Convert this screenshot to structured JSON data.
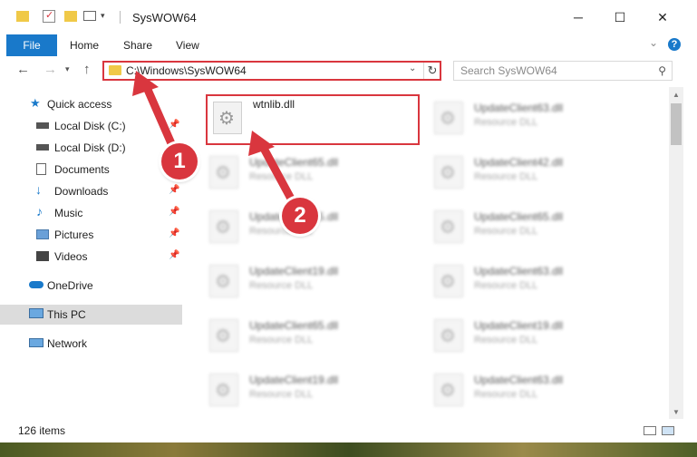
{
  "window": {
    "title": "SysWOW64"
  },
  "ribbon": {
    "tabs": [
      "File",
      "Home",
      "Share",
      "View"
    ],
    "help": "?"
  },
  "nav": {
    "address": "C:\\Windows\\SysWOW64",
    "search_placeholder": "Search SysWOW64"
  },
  "sidebar": {
    "items": [
      {
        "label": "Quick access",
        "icon": "star-icon"
      },
      {
        "label": "Local Disk (C:)",
        "icon": "drive-icon"
      },
      {
        "label": "Local Disk (D:)",
        "icon": "drive-icon"
      },
      {
        "label": "Documents",
        "icon": "documents-icon"
      },
      {
        "label": "Downloads",
        "icon": "download-icon"
      },
      {
        "label": "Music",
        "icon": "music-icon"
      },
      {
        "label": "Pictures",
        "icon": "pictures-icon"
      },
      {
        "label": "Videos",
        "icon": "videos-icon"
      },
      {
        "label": "OneDrive",
        "icon": "cloud-icon"
      },
      {
        "label": "This PC",
        "icon": "computer-icon"
      },
      {
        "label": "Network",
        "icon": "network-icon"
      }
    ]
  },
  "files": [
    {
      "name": "wtnlib.dll",
      "type": ""
    },
    {
      "name": "UpdateClient63.dll",
      "type": "Resource DLL"
    },
    {
      "name": "UpdateClient65.dll",
      "type": "Resource DLL"
    },
    {
      "name": "UpdateClient42.dll",
      "type": "Resource DLL"
    },
    {
      "name": "UpdateClient65.dll",
      "type": "Resource DLL"
    },
    {
      "name": "UpdateClient65.dll",
      "type": "Resource DLL"
    },
    {
      "name": "UpdateClient19.dll",
      "type": "Resource DLL"
    },
    {
      "name": "UpdateClient63.dll",
      "type": "Resource DLL"
    },
    {
      "name": "UpdateClient65.dll",
      "type": "Resource DLL"
    },
    {
      "name": "UpdateClient19.dll",
      "type": "Resource DLL"
    },
    {
      "name": "UpdateClient19.dll",
      "type": "Resource DLL"
    },
    {
      "name": "UpdateClient63.dll",
      "type": "Resource DLL"
    }
  ],
  "status": {
    "count": "126 items"
  },
  "annotations": {
    "step1": "1",
    "step2": "2"
  },
  "colors": {
    "accent": "#1979ca",
    "highlight": "#d9363e"
  }
}
